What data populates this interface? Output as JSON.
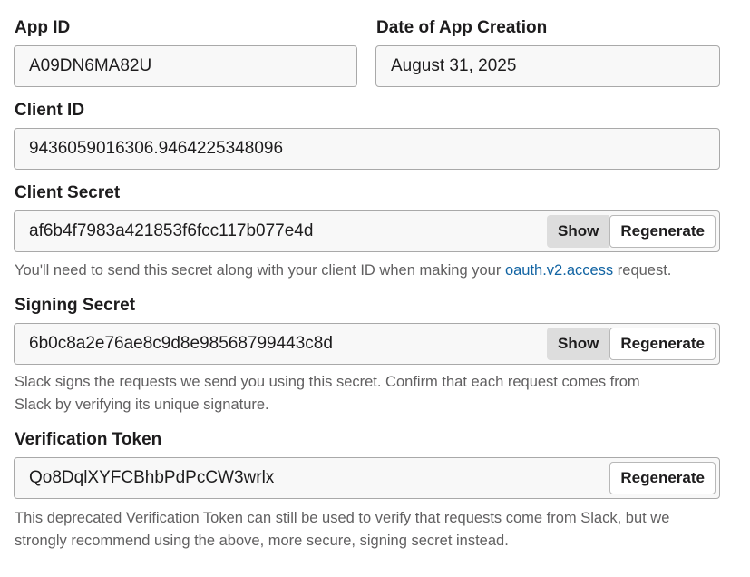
{
  "app_id": {
    "label": "App ID",
    "value": "A09DN6MA82U"
  },
  "creation_date": {
    "label": "Date of App Creation",
    "value": "August 31, 2025"
  },
  "client_id": {
    "label": "Client ID",
    "value": "9436059016306.9464225348096"
  },
  "client_secret": {
    "label": "Client Secret",
    "value": "af6b4f7983a421853f6fcc117b077e4d",
    "show_label": "Show",
    "regenerate_label": "Regenerate",
    "help_before": "You'll need to send this secret along with your client ID when making your ",
    "help_link": "oauth.v2.access",
    "help_after": " request."
  },
  "signing_secret": {
    "label": "Signing Secret",
    "value": "6b0c8a2e76ae8c9d8e98568799443c8d",
    "show_label": "Show",
    "regenerate_label": "Regenerate",
    "help_line1": "Slack signs the requests we send you using this secret. Confirm that each request comes from",
    "help_line2": "Slack by verifying its unique signature."
  },
  "verification_token": {
    "label": "Verification Token",
    "value": "Qo8DqlXYFCBhbPdPcCW3wrlx",
    "regenerate_label": "Regenerate",
    "help_line1": "This deprecated Verification Token can still be used to verify that requests come from Slack, but we",
    "help_line2": "strongly recommend using the above, more secure, signing secret instead."
  },
  "colors": {
    "text": "#1d1c1d",
    "muted": "#616061",
    "link": "#1264a3",
    "field_bg": "#f8f8f8",
    "field_border": "#a9a9a9",
    "show_bg": "#dddddd"
  }
}
